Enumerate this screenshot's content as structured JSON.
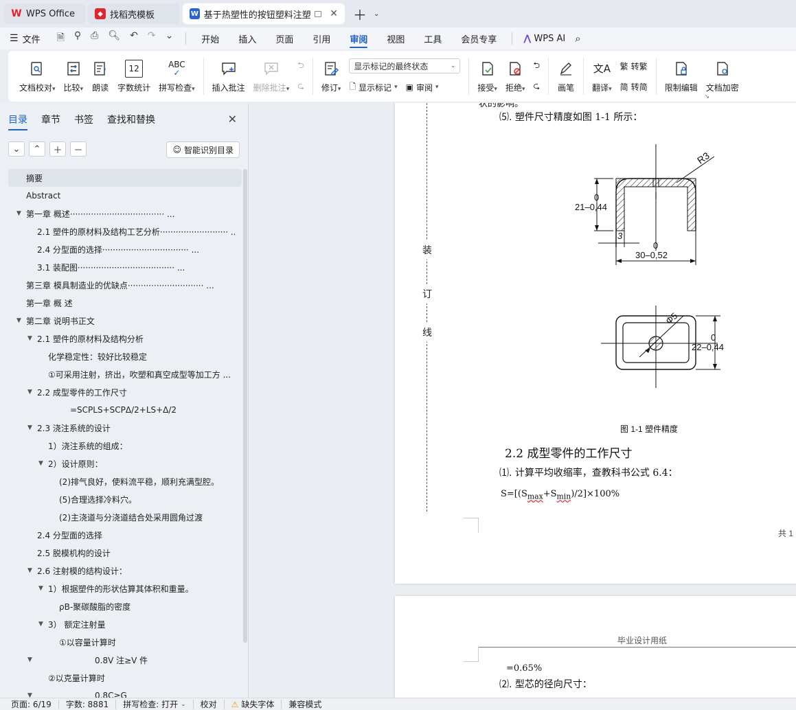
{
  "tabs": [
    {
      "label": "WPS Office",
      "icon": "wps-logo-icon"
    },
    {
      "label": "找稻壳模板",
      "icon": "docer-icon"
    },
    {
      "label": "基于热塑性的按钮塑料注塑模",
      "icon": "word-doc-icon"
    }
  ],
  "menubar": {
    "file": "文件",
    "items": [
      "开始",
      "插入",
      "页面",
      "引用",
      "审阅",
      "视图",
      "工具",
      "会员专享"
    ],
    "active": "审阅",
    "wps_ai": "WPS AI"
  },
  "ribbon": {
    "proofread": "文档校对",
    "compare": "比较",
    "read_aloud": "朗读",
    "word_count": "字数统计",
    "spell_check": "拼写检查",
    "insert_comment": "插入批注",
    "delete_comment": "删除批注",
    "revise": "修订",
    "markup_select": "显示标记的最终状态",
    "show_markup": "显示标记",
    "review": "审阅",
    "accept": "接受",
    "reject": "拒绝",
    "pen": "画笔",
    "translate": "翻译",
    "to_traditional": "转繁",
    "to_simplified": "转简",
    "restrict_edit": "限制编辑",
    "doc_encrypt": "文档加密",
    "word_count_icon_text": "12",
    "spell_icon_text": "ABC"
  },
  "leftpanel": {
    "tabs": [
      "目录",
      "章节",
      "书签",
      "查找和替换"
    ],
    "smart_button": "智能识别目录",
    "toc": [
      {
        "text": "摘要",
        "level": 0,
        "arrow": false,
        "selected": true
      },
      {
        "text": "Abstract",
        "level": 0,
        "arrow": false
      },
      {
        "text": "第一章  概述····································  ...",
        "level": 0,
        "arrow": true
      },
      {
        "text": "2.1   塑件的原材料及结构工艺分析··························  ...",
        "level": 1,
        "arrow": false
      },
      {
        "text": "2.4   分型面的选择·································  ...",
        "level": 1,
        "arrow": false
      },
      {
        "text": "3.1   装配图·····································  ...",
        "level": 1,
        "arrow": false
      },
      {
        "text": "第三章  模具制造业的优缺点·····························  ...",
        "level": 0,
        "arrow": false
      },
      {
        "text": "第一章  概     述",
        "level": 0,
        "arrow": false
      },
      {
        "text": "第二章  说明书正文",
        "level": 0,
        "arrow": true
      },
      {
        "text": "2.1  塑件的原材料及结构分析",
        "level": 1,
        "arrow": true
      },
      {
        "text": "化学稳定性：较好比较稳定",
        "level": 2,
        "arrow": false
      },
      {
        "text": "①可采用注射，挤出，吹塑和真空成型等加工方 ...",
        "level": 2,
        "arrow": false
      },
      {
        "text": "2.2  成型零件的工作尺寸",
        "level": 1,
        "arrow": true
      },
      {
        "text": "=SCPLS+SCPΔ/2+LS+Δ/2",
        "level": 4,
        "arrow": false
      },
      {
        "text": "2.3  浇注系统的设计",
        "level": 1,
        "arrow": true
      },
      {
        "text": "1）浇注系统的组成：",
        "level": 2,
        "arrow": false
      },
      {
        "text": "2）设计原则：",
        "level": 2,
        "arrow": true
      },
      {
        "text": "(2)排气良好，使料流平稳，顺利充满型腔。",
        "level": 3,
        "arrow": false
      },
      {
        "text": "(5)合理选择冷料穴。",
        "level": 3,
        "arrow": false
      },
      {
        "text": "(2)主浇道与分浇道结合处采用圆角过渡",
        "level": 3,
        "arrow": false
      },
      {
        "text": "2.4  分型面的选择",
        "level": 1,
        "arrow": false
      },
      {
        "text": "2.5  脱模机构的设计",
        "level": 1,
        "arrow": false
      },
      {
        "text": "2.6  注射模的结构设计：",
        "level": 1,
        "arrow": true
      },
      {
        "text": "1）根据塑件的形状估算其体积和重量。",
        "level": 2,
        "arrow": true
      },
      {
        "text": "ρB-聚碳酸脂的密度",
        "level": 3,
        "arrow": false
      },
      {
        "text": "3）    额定注射量",
        "level": 2,
        "arrow": true
      },
      {
        "text": "①以容量计算时",
        "level": 3,
        "arrow": false
      },
      {
        "text": "0.8V 注≥V 件",
        "level": 5,
        "arrow": true
      },
      {
        "text": "②以克量计算时",
        "level": 2,
        "arrow": false
      },
      {
        "text": "0.8C≥G",
        "level": 5,
        "arrow": true
      }
    ]
  },
  "document": {
    "top_cut": "状的影响。",
    "item5": "⑸. 塑件尺寸精度如图 1-1 所示：",
    "binding": [
      "装",
      "订",
      "线"
    ],
    "fig_labels": {
      "r3": "R3",
      "dim21": "21–0,44",
      "zero_a": "0",
      "dim3": "3",
      "zero_b": "0",
      "dim30": "30–0,52",
      "dia5": "Φ5",
      "dim22": "22–0,44",
      "zero_c": "0"
    },
    "caption": "图 1-1 塑件精度",
    "heading": "2.2 成型零件的工作尺寸",
    "item1": "⑴. 计算平均收缩率，查教科书公式 6.4：",
    "formula_prefix": "S=[(S",
    "formula_max": "max",
    "formula_mid": "+S",
    "formula_min": "min",
    "formula_suffix": ")/2]×100%",
    "page_footer": "共 1",
    "page2_header": "毕业设计用纸",
    "page2_line1": "=0.65%",
    "page2_line2": "⑵. 型芯的径向尺寸："
  },
  "statusbar": {
    "page": "页面: 6/19",
    "words": "字数: 8881",
    "spell": "拼写检查: 打开",
    "proof": "校对",
    "missing_font": "缺失字体",
    "compat": "兼容模式"
  },
  "colors": {
    "accent": "#1a63d6",
    "wps_red": "#e0252b",
    "word_blue": "#2b62d9"
  }
}
